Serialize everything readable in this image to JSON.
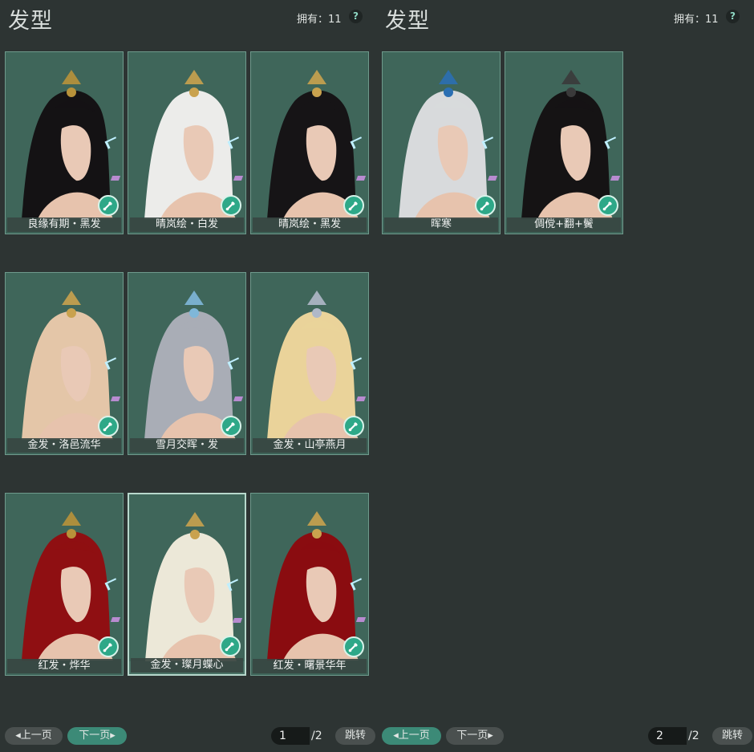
{
  "left_panel": {
    "title": "发型",
    "owned": "拥有：11",
    "help": "?",
    "cards": [
      {
        "label": "良缘有期・黑发",
        "hair": "#141214",
        "acc": "#b8923a"
      },
      {
        "label": "晴岚绘・白发",
        "hair": "#ececea",
        "acc": "#c9a24e"
      },
      {
        "label": "晴岚绘・黑发",
        "hair": "#161416",
        "acc": "#c9a24e"
      },
      {
        "label": "金发・洛邑流华",
        "hair": "#e4c6a8",
        "acc": "#c9a24e"
      },
      {
        "label": "雪月交晖・发",
        "hair": "#a9adb6",
        "acc": "#7fb7d9"
      },
      {
        "label": "金发・山亭燕月",
        "hair": "#ead39a",
        "acc": "#b0b8c8"
      },
      {
        "label": "红发・烨华",
        "hair": "#8f0f12",
        "acc": "#b8923a"
      },
      {
        "label": "金发・璨月蝶心",
        "hair": "#ece8d8",
        "acc": "#c9a24e"
      },
      {
        "label": "红发・曙景华年",
        "hair": "#8a0c10",
        "acc": "#c9a24e"
      }
    ],
    "prev_label": "上一页",
    "next_label": "下一页",
    "page_current": "1",
    "page_total": "/2",
    "jump_label": "跳转"
  },
  "right_panel": {
    "title": "发型",
    "owned": "拥有：11",
    "help": "?",
    "cards": [
      {
        "label": "晖寒",
        "hair": "#d8dadc",
        "acc": "#2b6fb3"
      },
      {
        "label": "倜傥+翻+鬢",
        "hair": "#151314",
        "acc": "#3a3a3a"
      }
    ],
    "prev_label": "上一页",
    "next_label": "下一页",
    "page_current": "2",
    "page_total": "/2",
    "jump_label": "跳转"
  },
  "colors": {
    "background": "#2d3433",
    "card_bg": "#3e6358",
    "accent": "#3c8a77"
  }
}
